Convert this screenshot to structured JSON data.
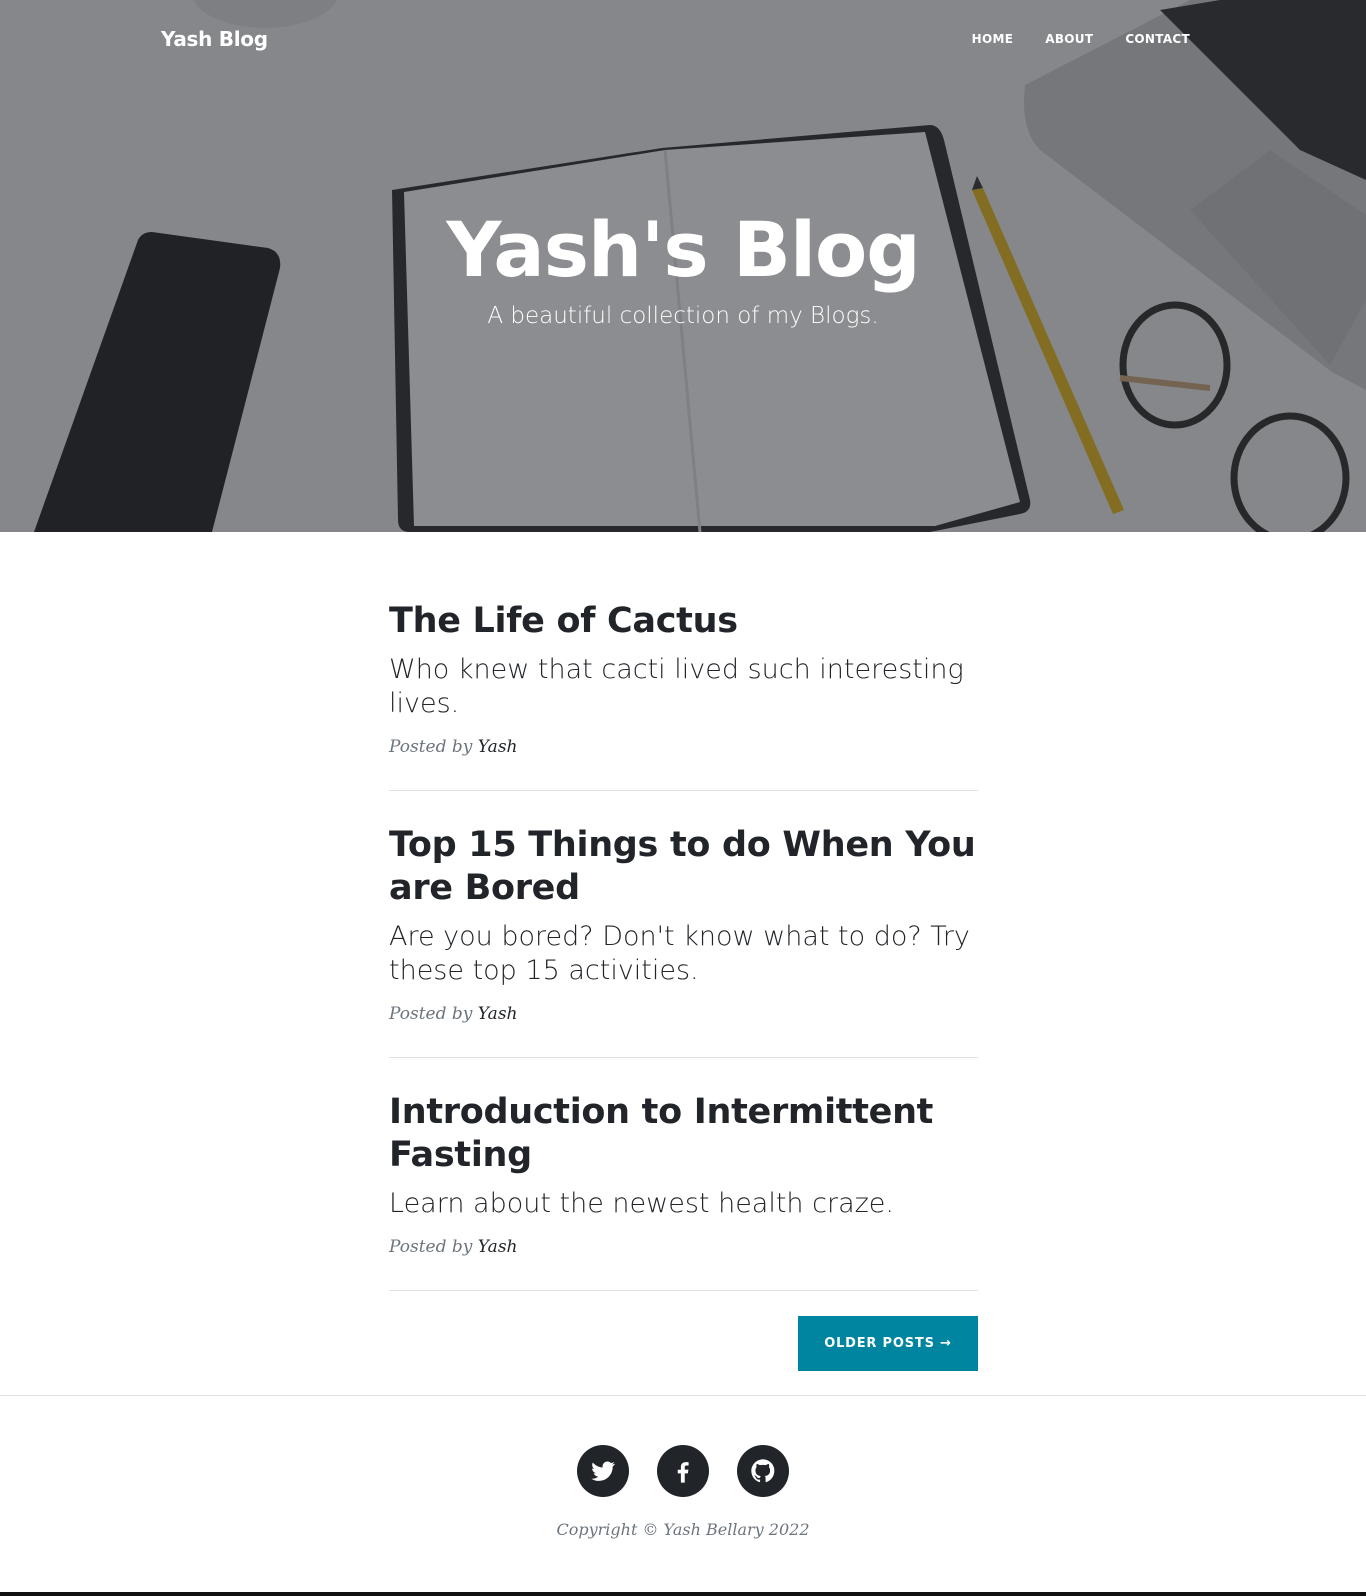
{
  "nav": {
    "brand": "Yash Blog",
    "links": [
      "HOME",
      "ABOUT",
      "CONTACT"
    ]
  },
  "hero": {
    "title": "Yash's Blog",
    "subtitle": "A beautiful collection of my Blogs."
  },
  "posts": [
    {
      "title": "The Life of Cactus",
      "subtitle": "Who knew that cacti lived such interesting lives.",
      "meta_prefix": "Posted by",
      "author": "Yash"
    },
    {
      "title": "Top 15 Things to do When You are Bored",
      "subtitle": "Are you bored? Don't know what to do? Try these top 15 activities.",
      "meta_prefix": "Posted by",
      "author": "Yash"
    },
    {
      "title": "Introduction to Intermittent Fasting",
      "subtitle": "Learn about the newest health craze.",
      "meta_prefix": "Posted by",
      "author": "Yash"
    }
  ],
  "pager": {
    "older_label": "OLDER POSTS →"
  },
  "footer": {
    "socials": [
      "twitter-icon",
      "facebook-icon",
      "github-icon"
    ],
    "copyright": "Copyright © Yash Bellary 2022"
  },
  "colors": {
    "accent": "#0085a1",
    "text": "#212529",
    "muted": "#6c757d"
  }
}
